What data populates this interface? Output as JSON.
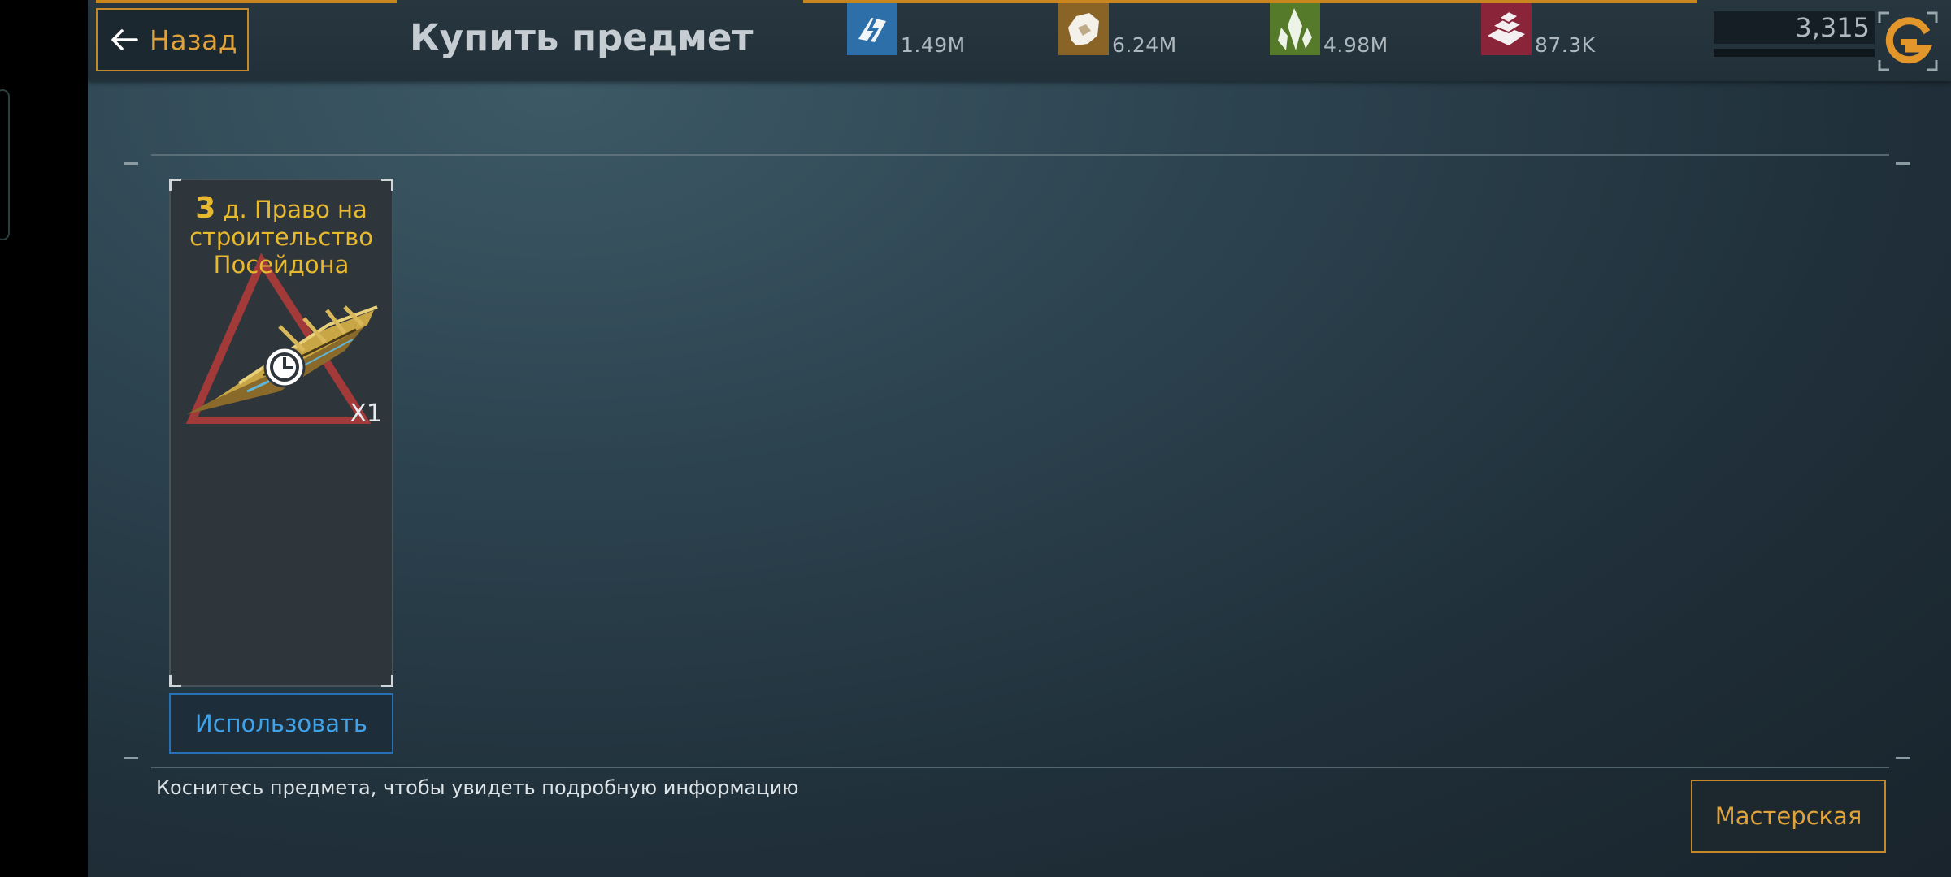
{
  "header": {
    "back_label": "Назад",
    "title": "Купить предмет"
  },
  "resources": [
    {
      "icon": "energy-icon",
      "value": "1.49M",
      "color": "#2d6fa8"
    },
    {
      "icon": "ore-icon",
      "value": "6.24M",
      "color": "#8a6426"
    },
    {
      "icon": "crystal-icon",
      "value": "4.98M",
      "color": "#557a2a"
    },
    {
      "icon": "alloy-icon",
      "value": "87.3K",
      "color": "#8a2438"
    }
  ],
  "credits": {
    "value": "3,315",
    "icon": "g-currency-icon"
  },
  "item": {
    "title_prefix": "3",
    "title_text": " д. Право на строительство Посейдона",
    "quantity": "X1",
    "icons": [
      "ship-icon",
      "clock-icon"
    ]
  },
  "actions": {
    "use_label": "Использовать",
    "workshop_label": "Мастерская"
  },
  "hint": "Коснитесь предмета, чтобы увидеть подробную информацию",
  "colors": {
    "accent": "#e0a33b",
    "blue": "#3ea3ea",
    "gold_text": "#e7b92e"
  }
}
